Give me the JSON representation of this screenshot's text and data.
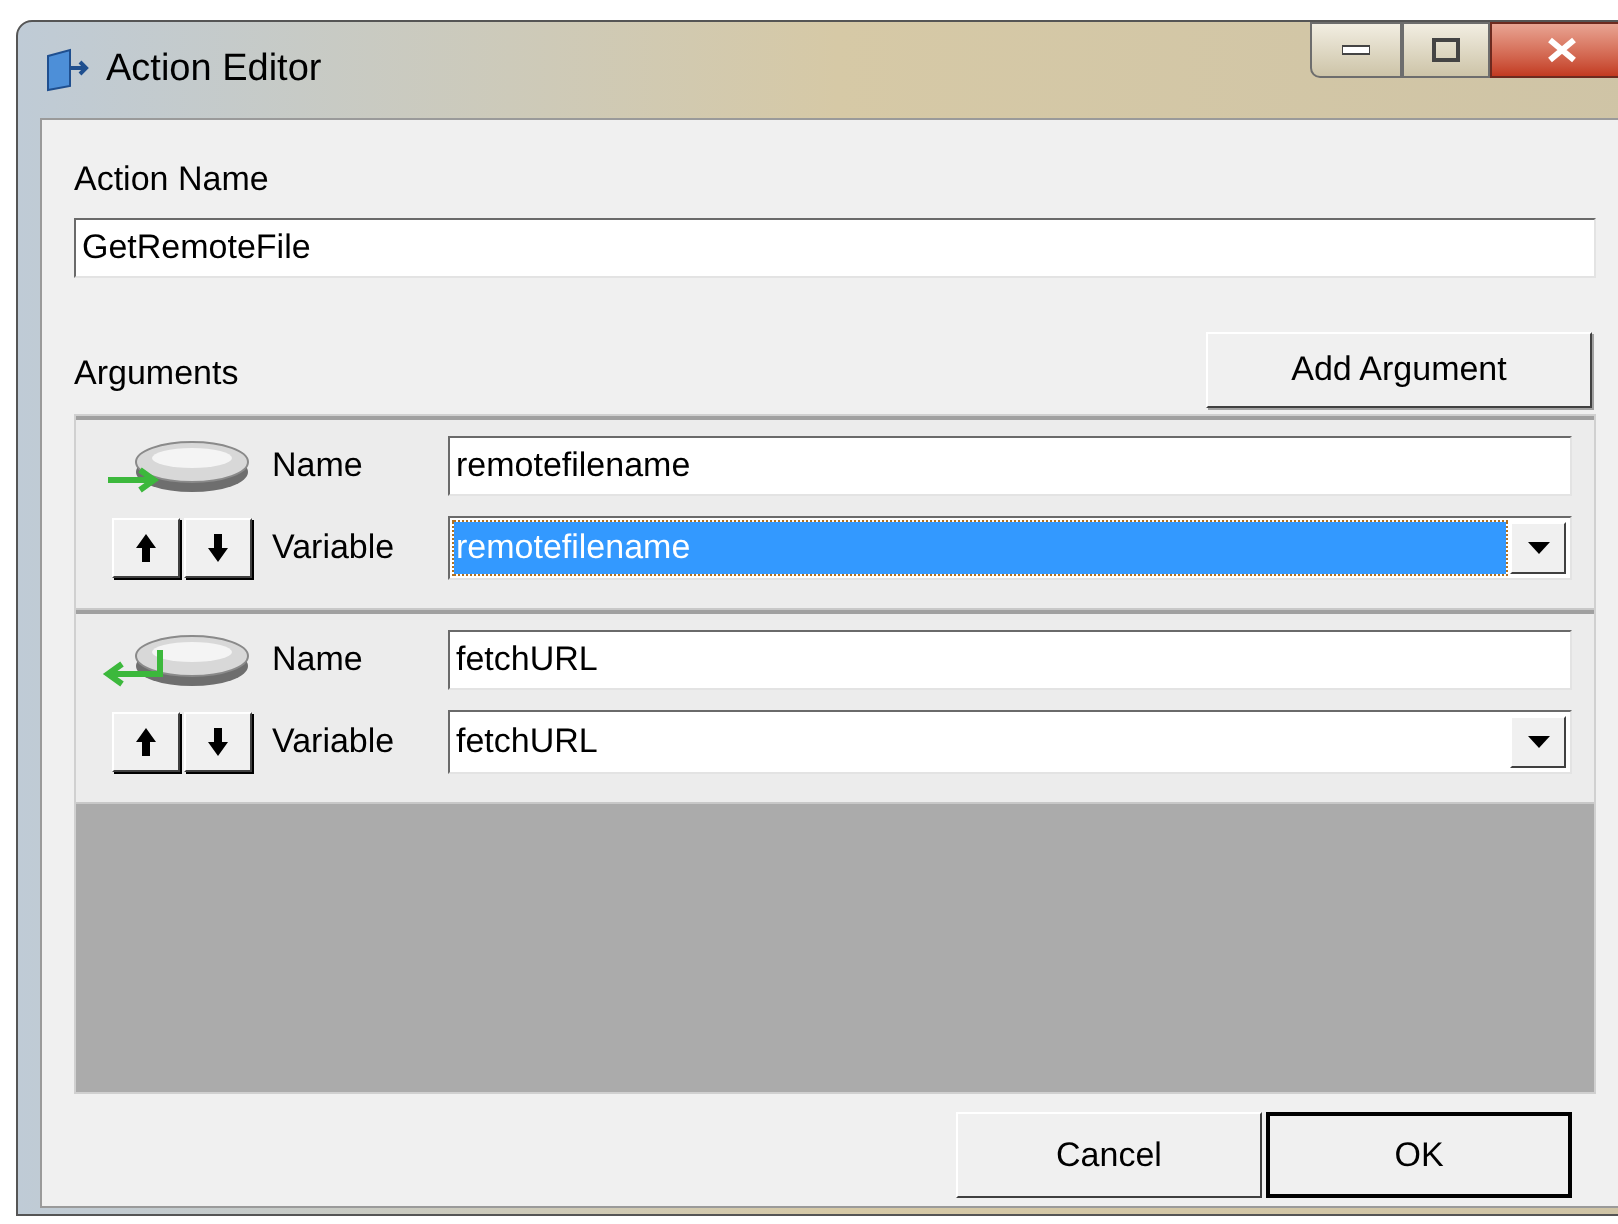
{
  "window": {
    "title": "Action Editor"
  },
  "action_name": {
    "label": "Action Name",
    "value": "GetRemoteFile"
  },
  "arguments": {
    "label": "Arguments",
    "add_button": "Add Argument",
    "items": [
      {
        "kind": "input",
        "name_label": "Name",
        "name": "remotefilename",
        "variable_label": "Variable",
        "variable": "remotefilename",
        "selected": true
      },
      {
        "kind": "output",
        "name_label": "Name",
        "name": "fetchURL",
        "variable_label": "Variable",
        "variable": "fetchURL",
        "selected": false
      }
    ]
  },
  "buttons": [
    {
      "label": "Cancel",
      "default": false
    },
    {
      "label": "OK",
      "default": true
    }
  ]
}
